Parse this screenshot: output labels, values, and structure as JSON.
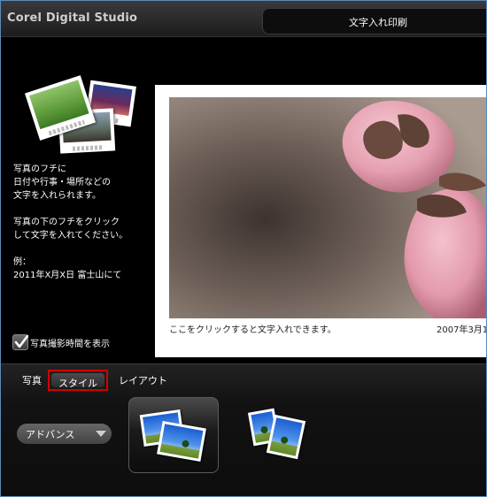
{
  "window": {
    "app_title": "Corel Digital Studio",
    "tab_title": "文字入れ印刷"
  },
  "sidebar": {
    "description": [
      "写真のフチに",
      "日付や行事・場所などの",
      "文字を入れられます。",
      "",
      "写真の下のフチをクリック",
      "して文字を入れてください。",
      "",
      "例：",
      "2011年X月X日 富士山にて"
    ],
    "show_time_label": "写真撮影時間を表示",
    "show_time_checked": true
  },
  "preview": {
    "caption_placeholder": "ここをクリックすると文字入れできます。",
    "date_text": "2007年3月1"
  },
  "bottom_tabs": {
    "photo": "写真",
    "style": "スタイル",
    "layout": "レイアウト"
  },
  "style_mode": {
    "selected": "アドバンス"
  },
  "colors": {
    "highlight": "#d40000",
    "blossom_pink": "#e9a9b6"
  }
}
